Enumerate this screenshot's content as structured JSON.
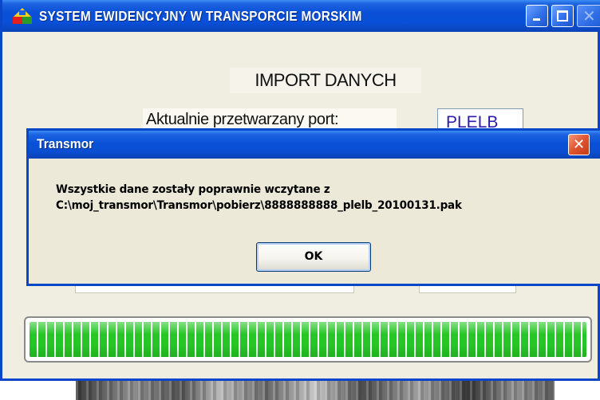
{
  "main_window": {
    "title": "SYSTEM  EWIDENCYJNY  W  TRANSPORCIE  MORSKIM",
    "app_icon": "app-logo-icon",
    "controls": {
      "minimize": "minimize-icon",
      "maximize": "maximize-icon",
      "close": "close-icon"
    }
  },
  "import_panel": {
    "heading": "IMPORT DANYCH",
    "current_port_label": "Aktualnie przetwarzany port:",
    "current_port_value": "PLELB"
  },
  "dialog": {
    "title": "Transmor",
    "close_icon": "close-icon",
    "message_line_1": "Wszystkie dane zostały poprawnie wczytane z",
    "message_line_2": "C:\\moj_transmor\\Transmor\\pobierz\\8888888888_plelb_20100131.pak",
    "ok_label": "OK"
  },
  "progress": {
    "percent": 100,
    "color": "#27c627"
  },
  "colors": {
    "titlebar_blue": "#0a4fd6",
    "window_bg": "#f0ede1",
    "dialog_bg": "#ece9d8",
    "close_red": "#e0532f"
  }
}
